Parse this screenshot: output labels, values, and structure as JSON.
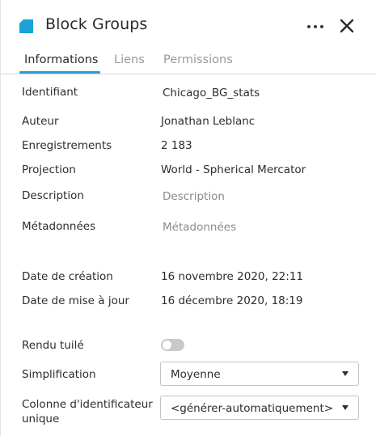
{
  "header": {
    "title": "Block Groups",
    "icons": {
      "layer": "layer-shape-icon",
      "more": "more-horizontal-icon",
      "close": "close-icon"
    }
  },
  "tabs": [
    {
      "label": "Informations",
      "active": true
    },
    {
      "label": "Liens",
      "active": false
    },
    {
      "label": "Permissions",
      "active": false
    }
  ],
  "fields": {
    "identifiant": {
      "label": "Identifiant",
      "value": "Chicago_BG_stats"
    },
    "auteur": {
      "label": "Auteur",
      "value": "Jonathan Leblanc"
    },
    "enregistrements": {
      "label": "Enregistrements",
      "value": "2 183"
    },
    "projection": {
      "label": "Projection",
      "value": "World - Spherical Mercator"
    },
    "description": {
      "label": "Description",
      "placeholder": "Description"
    },
    "metadonnees": {
      "label": "Métadonnées",
      "placeholder": "Métadonnées"
    },
    "date_creation": {
      "label": "Date de création",
      "value": "16 novembre 2020, 22:11"
    },
    "date_maj": {
      "label": "Date de mise à jour",
      "value": "16 décembre 2020, 18:19"
    },
    "rendu_tuile": {
      "label": "Rendu tuilé",
      "enabled": false
    },
    "simplification": {
      "label": "Simplification",
      "selected": "Moyenne"
    },
    "colonne_id": {
      "label": "Colonne d'identificateur unique",
      "selected": "<générer-automatiquement>"
    }
  },
  "colors": {
    "accent": "#1aa3d9",
    "toggle_off": "#c9c9c9",
    "text": "#2d2d2d",
    "muted": "#8a8a8a"
  }
}
